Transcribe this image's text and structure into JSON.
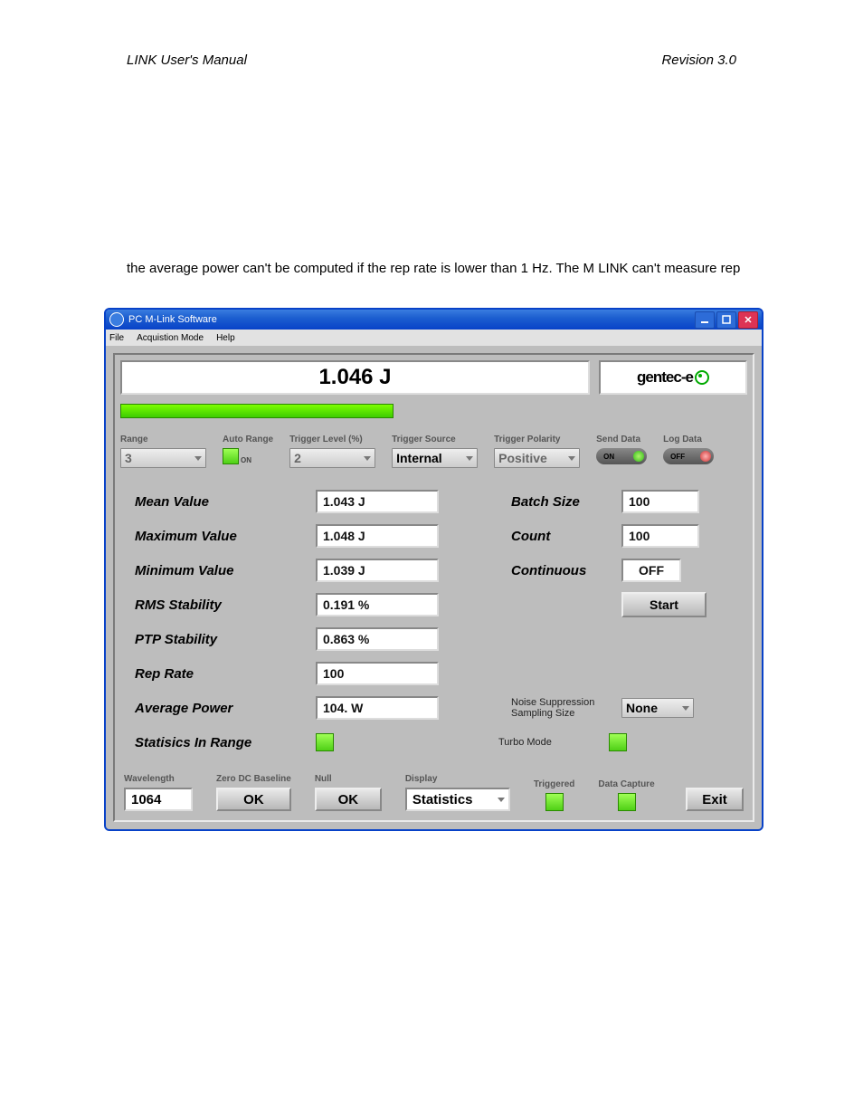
{
  "doc": {
    "header_left": "LINK User's Manual",
    "header_right": "Revision 3.0",
    "body_text": "the average power can't be computed if the rep rate is lower than 1 Hz. The M LINK can't measure rep"
  },
  "window": {
    "title": "PC M-Link Software",
    "menu": [
      "File",
      "Acquistion Mode",
      "Help"
    ]
  },
  "top": {
    "readout": "1.046 J",
    "logo": "gentec-e"
  },
  "controls": {
    "range": {
      "label": "Range",
      "value": "3"
    },
    "auto_range": {
      "label": "Auto Range",
      "value": "ON"
    },
    "trigger_level": {
      "label": "Trigger Level (%)",
      "value": "2"
    },
    "trigger_source": {
      "label": "Trigger Source",
      "value": "Internal"
    },
    "trigger_polarity": {
      "label": "Trigger Polarity",
      "value": "Positive"
    },
    "send_data": {
      "label": "Send Data",
      "value": "ON"
    },
    "log_data": {
      "label": "Log Data",
      "value": "OFF"
    }
  },
  "stats": {
    "mean": {
      "label": "Mean Value",
      "value": "1.043 J"
    },
    "max": {
      "label": "Maximum Value",
      "value": "1.048 J"
    },
    "min": {
      "label": "Minimum Value",
      "value": "1.039 J"
    },
    "rms": {
      "label": "RMS Stability",
      "value": "0.191 %"
    },
    "ptp": {
      "label": "PTP Stability",
      "value": "0.863 %"
    },
    "rep": {
      "label": "Rep Rate",
      "value": "100"
    },
    "avg": {
      "label": "Average Power",
      "value": "104. W"
    },
    "inrange": {
      "label": "Statisics In Range"
    }
  },
  "right": {
    "batch": {
      "label": "Batch Size",
      "value": "100"
    },
    "count": {
      "label": "Count",
      "value": "100"
    },
    "cont": {
      "label": "Continuous",
      "value": "OFF"
    },
    "start": "Start",
    "noise": {
      "label": "Noise Suppression Sampling Size",
      "value": "None"
    },
    "turbo": {
      "label": "Turbo Mode"
    }
  },
  "bottom": {
    "wavelength": {
      "label": "Wavelength",
      "value": "1064"
    },
    "zero": {
      "label": "Zero DC Baseline",
      "value": "OK"
    },
    "null_": {
      "label": "Null",
      "value": "OK"
    },
    "display": {
      "label": "Display",
      "value": "Statistics"
    },
    "triggered": {
      "label": "Triggered"
    },
    "capture": {
      "label": "Data Capture"
    },
    "exit": "Exit"
  }
}
